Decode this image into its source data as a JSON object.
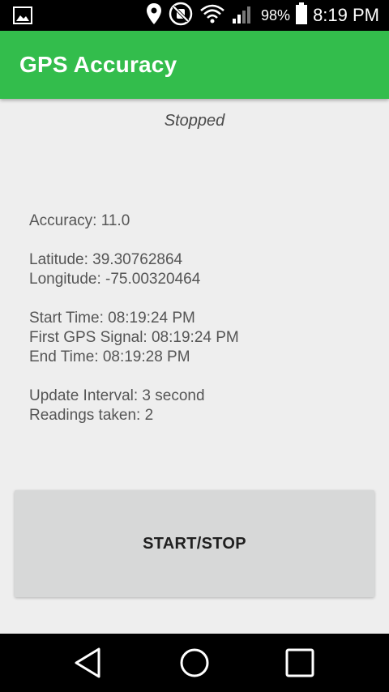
{
  "status_bar": {
    "battery_percent": "98%",
    "time": "8:19 PM",
    "icons": [
      "image-icon",
      "location-pin-icon",
      "mute-icon",
      "wifi-icon",
      "signal-icon",
      "battery-icon"
    ]
  },
  "app_bar": {
    "title": "GPS Accuracy",
    "color": "#33bd4c"
  },
  "status": "Stopped",
  "info": {
    "accuracy": "Accuracy: 11.0",
    "latitude": "Latitude: 39.30762864",
    "longitude": "Longitude: -75.00320464",
    "start_time": "Start Time: 08:19:24 PM",
    "first_gps_signal": "First GPS Signal: 08:19:24 PM",
    "end_time": "End Time: 08:19:28 PM",
    "update_interval": "Update Interval: 3 second",
    "readings_taken": "Readings taken: 2"
  },
  "button": {
    "label": "START/STOP"
  },
  "nav_bar": {
    "icons": [
      "back-icon",
      "home-icon",
      "recents-icon"
    ]
  }
}
